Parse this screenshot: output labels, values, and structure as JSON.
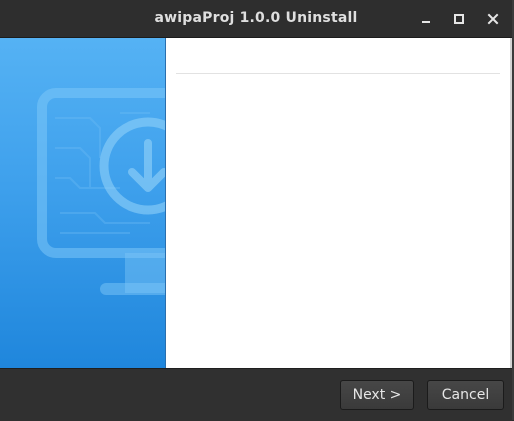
{
  "window": {
    "title": "awipaProj 1.0.0 Uninstall"
  },
  "titlebar_icons": {
    "minimize": "minimize-icon",
    "maximize": "maximize-icon",
    "close": "close-icon"
  },
  "side_panel": {
    "illustration": "monitor-download-icon"
  },
  "buttons": {
    "next_label": "Next >",
    "cancel_label": "Cancel"
  },
  "colors": {
    "side_panel_top": "#55b2f4",
    "side_panel_bottom": "#1f86dc",
    "chrome": "#2e2e2e"
  }
}
